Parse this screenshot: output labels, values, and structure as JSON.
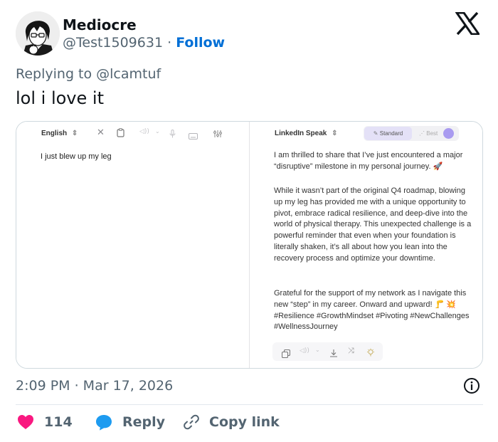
{
  "author": {
    "name": "Mediocre",
    "handle": "@Test1509631",
    "separator": "·",
    "follow_label": "Follow"
  },
  "tweet": {
    "replying_to": "Replying to @lcamtuf",
    "text": "lol i love it",
    "timestamp": "2:09 PM · Mar 17, 2026"
  },
  "screenshot": {
    "left_pane": {
      "language": "English",
      "input_text": "I just blew up my leg"
    },
    "right_pane": {
      "mode": "LinkedIn Speak",
      "seg_standard": "Standard",
      "seg_best": "Best",
      "paragraph1": "I am thrilled to share that I’ve just encountered a major “disruptive” milestone in my personal journey. 🚀",
      "paragraph2": "While it wasn’t part of the original Q4 roadmap, blowing up my leg has provided me with a unique opportunity to pivot, embrace radical resilience, and deep-dive into the world of physical therapy. This unexpected challenge is a powerful reminder that even when your foundation is literally shaken, it’s all about how you lean into the recovery process and optimize your downtime.",
      "paragraph3": "Grateful for the support of my network as I navigate this new “step” in my career. Onward and upward! 🦵 💥 #Resilience #GrowthMindset #Pivoting #NewChallenges #WellnessJourney"
    }
  },
  "actions": {
    "like_count": "114",
    "reply_label": "Reply",
    "copy_link_label": "Copy link"
  },
  "colors": {
    "like": "#f91880",
    "reply": "#1d9bf0",
    "follow": "#006fd6",
    "muted": "#536471"
  },
  "icons": [
    "x-logo-icon",
    "heart-icon",
    "reply-bubble-icon",
    "link-icon",
    "info-icon"
  ]
}
